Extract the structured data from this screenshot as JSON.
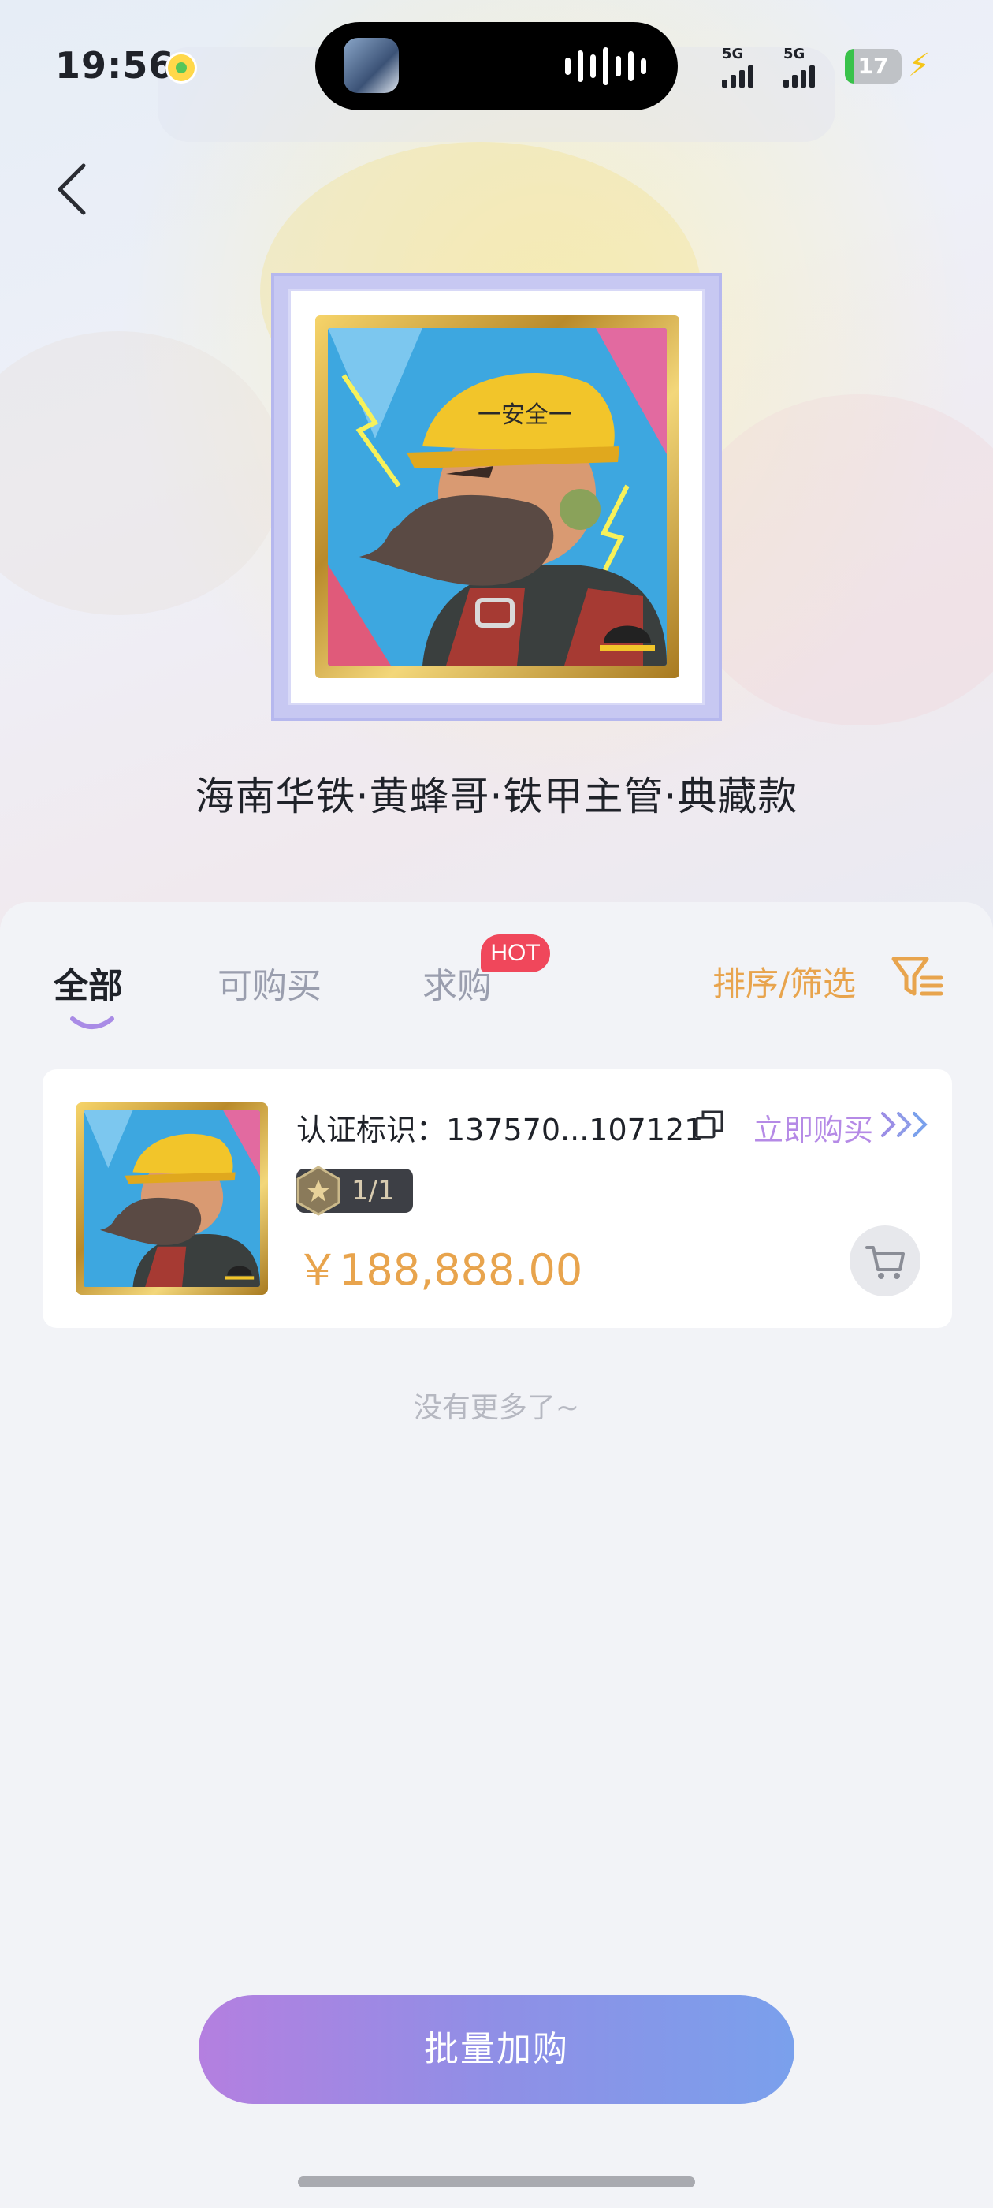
{
  "status_bar": {
    "time": "19:56",
    "network_1": "5G",
    "network_2": "5G",
    "battery": "17"
  },
  "header": {
    "title": "海南华铁·黄蜂哥·铁甲主管·典藏款"
  },
  "tabs": [
    {
      "label": "全部",
      "active": true
    },
    {
      "label": "可购买",
      "active": false
    },
    {
      "label": "求购",
      "active": false,
      "badge": "HOT"
    }
  ],
  "sort_filter_label": "排序/筛选",
  "items": [
    {
      "cert_label": "认证标识：137570...107121",
      "buy_label": "立即购买",
      "edition": "1/1",
      "price": "￥188,888.00"
    }
  ],
  "list_end_text": "没有更多了~",
  "batch_button_label": "批量加购",
  "colors": {
    "accent_orange": "#e8a44d",
    "accent_purple": "#b58ae6",
    "hot_badge": "#f0475b",
    "button_gradient_start": "#b47fe0",
    "button_gradient_end": "#7aa0ec"
  },
  "icons": [
    "back-arrow-icon",
    "copy-icon",
    "chevron-right-icon",
    "filter-icon",
    "cart-icon",
    "star-badge-icon"
  ]
}
